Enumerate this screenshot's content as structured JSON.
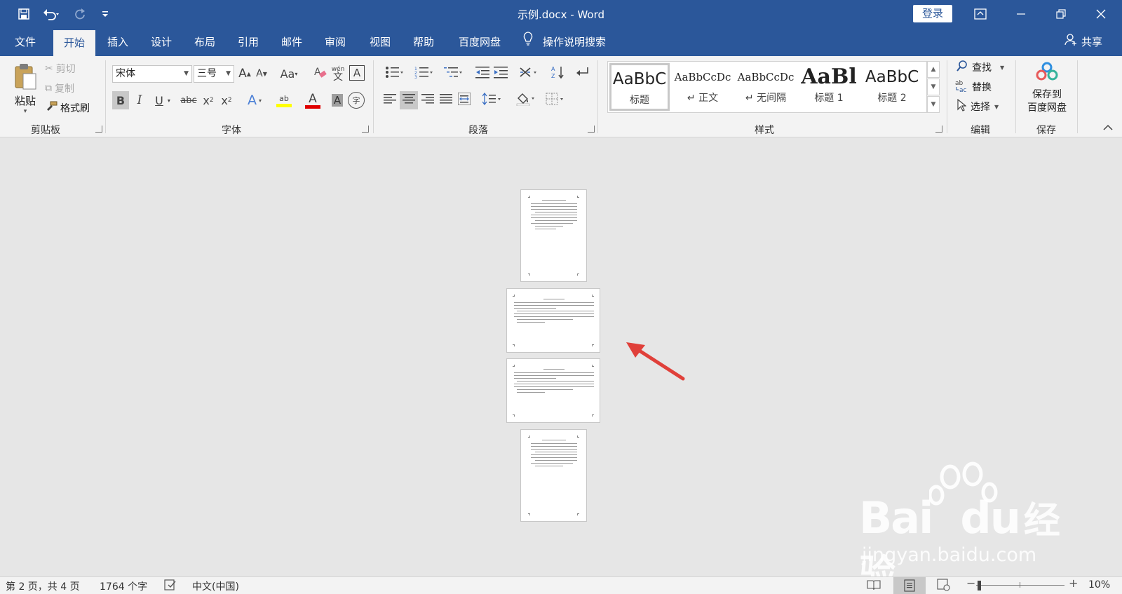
{
  "titlebar": {
    "doc_title": "示例.docx  -  Word",
    "login": "登录",
    "icons": [
      "save-icon",
      "undo-icon",
      "redo-icon",
      "customize-icon",
      "ribbon-display-icon",
      "minimize-icon",
      "restore-icon",
      "close-icon"
    ]
  },
  "tabs": [
    {
      "label": "文件"
    },
    {
      "label": "开始"
    },
    {
      "label": "插入"
    },
    {
      "label": "设计"
    },
    {
      "label": "布局"
    },
    {
      "label": "引用"
    },
    {
      "label": "邮件"
    },
    {
      "label": "审阅"
    },
    {
      "label": "视图"
    },
    {
      "label": "帮助"
    },
    {
      "label": "百度网盘"
    }
  ],
  "tell_me": "操作说明搜索",
  "share": "共享",
  "clipboard": {
    "paste": "粘贴",
    "cut": "剪切",
    "copy": "复制",
    "format_painter": "格式刷",
    "label": "剪贴板"
  },
  "font": {
    "name": "宋体",
    "size": "三号",
    "grow": "A",
    "shrink": "A",
    "case": "Aa",
    "phonetic_top": "wén",
    "phonetic_bottom": "文",
    "border_char": "A",
    "bold": "B",
    "italic": "I",
    "underline": "U",
    "strike": "abc",
    "sub": "x",
    "sup": "x",
    "effects": "A",
    "highlight": "ab",
    "color": "A",
    "shading": "A",
    "enclose": "字",
    "label": "字体"
  },
  "paragraph": {
    "label": "段落"
  },
  "styles": {
    "label": "样式",
    "items": [
      {
        "preview": "AaBbC",
        "name": "标题"
      },
      {
        "preview": "AaBbCcDc",
        "name": "↵ 正文"
      },
      {
        "preview": "AaBbCcDc",
        "name": "↵ 无间隔"
      },
      {
        "preview": "AaBl",
        "name": "标题 1"
      },
      {
        "preview": "AaBbC",
        "name": "标题 2"
      }
    ]
  },
  "editing": {
    "find": "查找",
    "replace": "替换",
    "select": "选择",
    "label": "编辑"
  },
  "save": {
    "button_line1": "保存到",
    "button_line2": "百度网盘",
    "label": "保存"
  },
  "statusbar": {
    "page": "第 2 页，共 4 页",
    "words": "1764 个字",
    "language": "中文(中国)",
    "zoom": "10%"
  },
  "watermark": {
    "brand": "Bai",
    "brand2": "du",
    "cn": "经验",
    "url": "jingyan.baidu.com"
  },
  "colors": {
    "title_blue": "#2b579a",
    "arrow_red": "#e0403a",
    "highlight_yellow": "#ffff00",
    "font_red": "#e00000"
  }
}
